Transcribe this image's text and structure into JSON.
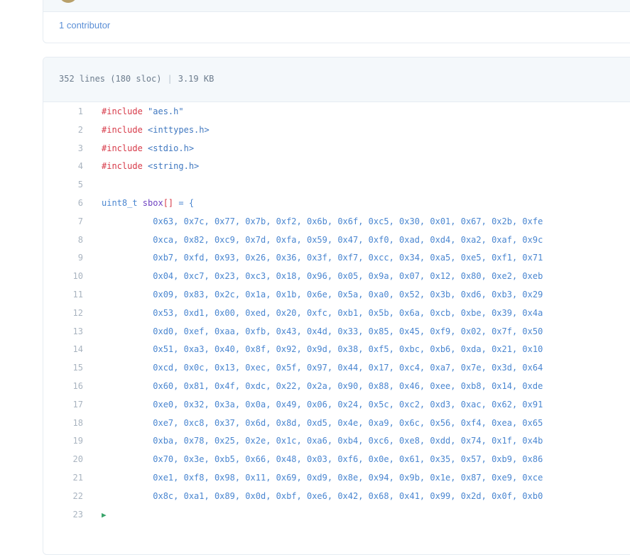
{
  "header": {
    "contributors_link": "1 contributor"
  },
  "file": {
    "lines_info": "352 lines (180 sloc)",
    "size": "3.19 KB"
  },
  "code_lines": [
    {
      "n": "1",
      "parts": [
        [
          "pp",
          "#include"
        ],
        [
          "str",
          " \"aes.h\""
        ]
      ]
    },
    {
      "n": "2",
      "parts": [
        [
          "pp",
          "#include"
        ],
        [
          "hdr",
          " <inttypes.h>"
        ]
      ]
    },
    {
      "n": "3",
      "parts": [
        [
          "pp",
          "#include"
        ],
        [
          "hdr",
          " <stdio.h>"
        ]
      ]
    },
    {
      "n": "4",
      "parts": [
        [
          "pp",
          "#include"
        ],
        [
          "hdr",
          " <string.h>"
        ]
      ]
    },
    {
      "n": "5",
      "parts": []
    },
    {
      "n": "6",
      "parts": [
        [
          "typ",
          "uint8_t"
        ],
        [
          "idn",
          " sbox"
        ],
        [
          "pp",
          "[]"
        ],
        [
          "typ",
          " = {"
        ]
      ]
    },
    {
      "n": "7",
      "parts": [
        [
          "hex",
          "          0x63, 0x7c, 0x77, 0x7b, 0xf2, 0x6b, 0x6f, 0xc5, 0x30, 0x01, 0x67, 0x2b, 0xfe"
        ]
      ]
    },
    {
      "n": "8",
      "parts": [
        [
          "hex",
          "          0xca, 0x82, 0xc9, 0x7d, 0xfa, 0x59, 0x47, 0xf0, 0xad, 0xd4, 0xa2, 0xaf, 0x9c"
        ]
      ]
    },
    {
      "n": "9",
      "parts": [
        [
          "hex",
          "          0xb7, 0xfd, 0x93, 0x26, 0x36, 0x3f, 0xf7, 0xcc, 0x34, 0xa5, 0xe5, 0xf1, 0x71"
        ]
      ]
    },
    {
      "n": "10",
      "parts": [
        [
          "hex",
          "          0x04, 0xc7, 0x23, 0xc3, 0x18, 0x96, 0x05, 0x9a, 0x07, 0x12, 0x80, 0xe2, 0xeb"
        ]
      ]
    },
    {
      "n": "11",
      "parts": [
        [
          "hex",
          "          0x09, 0x83, 0x2c, 0x1a, 0x1b, 0x6e, 0x5a, 0xa0, 0x52, 0x3b, 0xd6, 0xb3, 0x29"
        ]
      ]
    },
    {
      "n": "12",
      "parts": [
        [
          "hex",
          "          0x53, 0xd1, 0x00, 0xed, 0x20, 0xfc, 0xb1, 0x5b, 0x6a, 0xcb, 0xbe, 0x39, 0x4a"
        ]
      ]
    },
    {
      "n": "13",
      "parts": [
        [
          "hex",
          "          0xd0, 0xef, 0xaa, 0xfb, 0x43, 0x4d, 0x33, 0x85, 0x45, 0xf9, 0x02, 0x7f, 0x50"
        ]
      ]
    },
    {
      "n": "14",
      "parts": [
        [
          "hex",
          "          0x51, 0xa3, 0x40, 0x8f, 0x92, 0x9d, 0x38, 0xf5, 0xbc, 0xb6, 0xda, 0x21, 0x10"
        ]
      ]
    },
    {
      "n": "15",
      "parts": [
        [
          "hex",
          "          0xcd, 0x0c, 0x13, 0xec, 0x5f, 0x97, 0x44, 0x17, 0xc4, 0xa7, 0x7e, 0x3d, 0x64"
        ]
      ]
    },
    {
      "n": "16",
      "parts": [
        [
          "hex",
          "          0x60, 0x81, 0x4f, 0xdc, 0x22, 0x2a, 0x90, 0x88, 0x46, 0xee, 0xb8, 0x14, 0xde"
        ]
      ]
    },
    {
      "n": "17",
      "parts": [
        [
          "hex",
          "          0xe0, 0x32, 0x3a, 0x0a, 0x49, 0x06, 0x24, 0x5c, 0xc2, 0xd3, 0xac, 0x62, 0x91"
        ]
      ]
    },
    {
      "n": "18",
      "parts": [
        [
          "hex",
          "          0xe7, 0xc8, 0x37, 0x6d, 0x8d, 0xd5, 0x4e, 0xa9, 0x6c, 0x56, 0xf4, 0xea, 0x65"
        ]
      ]
    },
    {
      "n": "19",
      "parts": [
        [
          "hex",
          "          0xba, 0x78, 0x25, 0x2e, 0x1c, 0xa6, 0xb4, 0xc6, 0xe8, 0xdd, 0x74, 0x1f, 0x4b"
        ]
      ]
    },
    {
      "n": "20",
      "parts": [
        [
          "hex",
          "          0x70, 0x3e, 0xb5, 0x66, 0x48, 0x03, 0xf6, 0x0e, 0x61, 0x35, 0x57, 0xb9, 0x86"
        ]
      ]
    },
    {
      "n": "21",
      "parts": [
        [
          "hex",
          "          0xe1, 0xf8, 0x98, 0x11, 0x69, 0xd9, 0x8e, 0x94, 0x9b, 0x1e, 0x87, 0xe9, 0xce"
        ]
      ]
    },
    {
      "n": "22",
      "parts": [
        [
          "hex",
          "          0x8c, 0xa1, 0x89, 0x0d, 0xbf, 0xe6, 0x42, 0x68, 0x41, 0x99, 0x2d, 0x0f, 0xb0"
        ]
      ]
    },
    {
      "n": "23",
      "parts": []
    }
  ]
}
